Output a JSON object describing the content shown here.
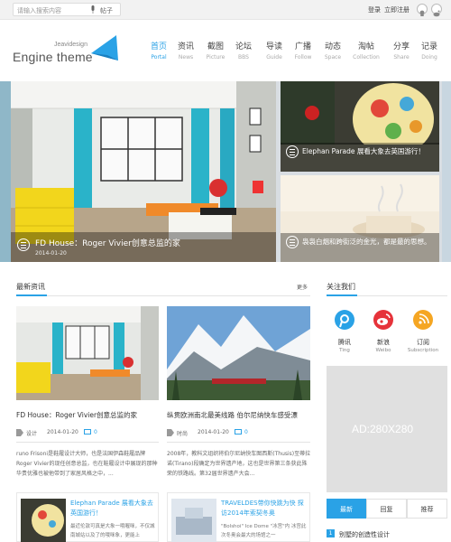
{
  "topbar": {
    "search_placeholder": "请输入搜索内容",
    "search_tie": "帖子",
    "login": "登录",
    "register": "立即注册"
  },
  "logo": {
    "sub": "Jeavidesign",
    "main": "Engine theme"
  },
  "nav": [
    {
      "zh": "首页",
      "en": "Portal"
    },
    {
      "zh": "资讯",
      "en": "News"
    },
    {
      "zh": "截图",
      "en": "Picture"
    },
    {
      "zh": "论坛",
      "en": "BBS"
    },
    {
      "zh": "导读",
      "en": "Guide"
    },
    {
      "zh": "广播",
      "en": "Follow"
    },
    {
      "zh": "动态",
      "en": "Space"
    },
    {
      "zh": "淘帖",
      "en": "Collection"
    },
    {
      "zh": "分享",
      "en": "Share"
    },
    {
      "zh": "记录",
      "en": "Doing"
    }
  ],
  "slider": {
    "main": {
      "title": "FD House：Roger Vivier创意总监的家",
      "date": "2014-01-20"
    },
    "right_top": {
      "title": "Elephan Parade 展看大象去英国游行！"
    },
    "right_bottom": {
      "title": "袅袅白烟和跨街泛的金光，都是最的思想。"
    }
  },
  "latest": {
    "heading": "最新资讯",
    "more": "更多",
    "cards": [
      {
        "title": "FD House：Roger Vivier创意总监的家",
        "tag": "设计",
        "date": "2014-01-20",
        "comments": "0",
        "body": "runo Frisoni是鞋履设计大师，也是法国伊森鞋履品牌Roger Vivier的现任创意总监，也在鞋履设计中展现的那种华贵优雅也被他带到了家居风格之中，..."
      },
      {
        "title": "纵贯欧洲南北最美线路 伯尔尼纳快车感受漂",
        "tag": "时尚",
        "date": "2014-01-20",
        "comments": "0",
        "body": "2008年，教科文组织将伯尔尼纳快车图西斯(Thusis)至蒂拉诺(Tirano)段确定为世界遗产地，这也是世界第三条获此殊荣的铁路线。第32届世界遗产大会..."
      }
    ],
    "small": [
      {
        "title": "Elephan Parade 展看大象去英国游行！",
        "body": "最近伦敦可真是大象一哦喔咪，不仅城南城站以及了的哦咪象，更能上"
      },
      {
        "title": "TRAVELDES带你快跳为快 探访2014年索契冬奥",
        "body": "\"Bolshoi\" Ice Dome \"冰宫\"内 冰宫此次冬奥会最大的场馆之一"
      }
    ]
  },
  "follow": {
    "heading": "关注我们",
    "items": [
      {
        "zh": "腾讯",
        "en": "Ting",
        "color": "#2aa2e6"
      },
      {
        "zh": "新浪",
        "en": "Weibo",
        "color": "#e6333a"
      },
      {
        "zh": "订阅",
        "en": "Subscription",
        "color": "#f5a623"
      }
    ]
  },
  "ad": {
    "label": "AD:280X280"
  },
  "tabs": [
    "最新",
    "回复",
    "推荐"
  ],
  "list": [
    {
      "num": "1",
      "text": "别墅的创造性设计"
    }
  ]
}
